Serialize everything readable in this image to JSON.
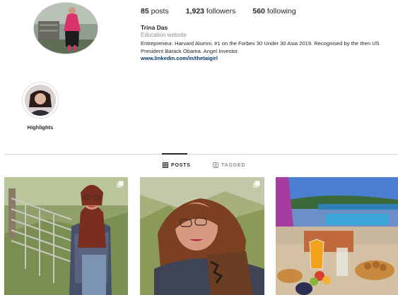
{
  "profile": {
    "posts_count": "85",
    "posts_label": "posts",
    "followers_count": "1,923",
    "followers_label": "followers",
    "following_count": "560",
    "following_label": "following",
    "name": "Trina Das",
    "category": "Education website",
    "bio": "Entrepreneur. Harvard Alumni. #1 on the Forbes 30 Under 30 Asia 2019. Recognised by the then US President Barack Obama. Angel Investor.",
    "link": "www.linkedin.com/in/thetaigirl"
  },
  "highlights": [
    {
      "label": "Highlights"
    }
  ],
  "tabs": {
    "posts": "POSTS",
    "tagged": "TAGGED"
  },
  "colors": {
    "text": "#262626",
    "muted": "#8e8e8e",
    "link": "#00376b",
    "border": "#dbdbdb"
  },
  "icons": {
    "posts_tab": "grid-icon",
    "tagged_tab": "tag-icon",
    "multi_post": "multiple-images-icon"
  }
}
